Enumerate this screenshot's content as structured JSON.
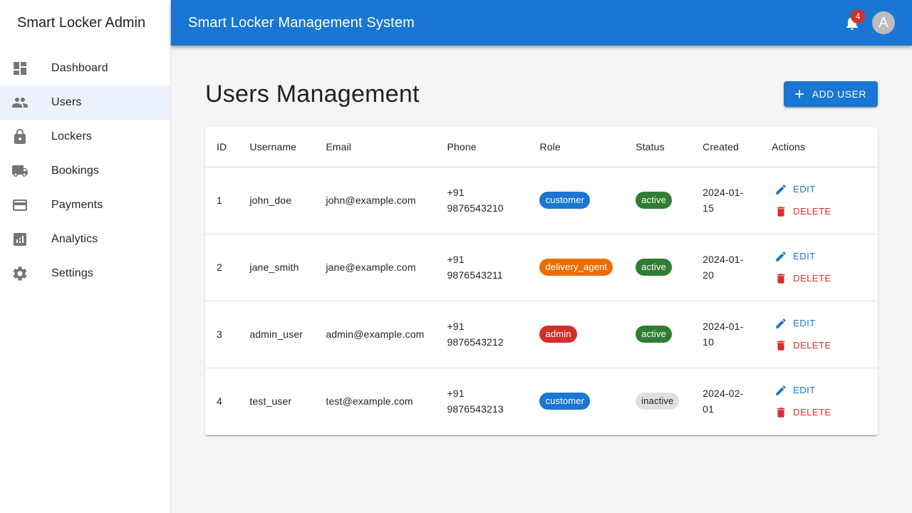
{
  "sidebar": {
    "brand": "Smart Locker Admin",
    "items": [
      {
        "label": "Dashboard",
        "icon": "dashboard-icon"
      },
      {
        "label": "Users",
        "icon": "people-icon",
        "active": true
      },
      {
        "label": "Lockers",
        "icon": "lock-icon"
      },
      {
        "label": "Bookings",
        "icon": "truck-icon"
      },
      {
        "label": "Payments",
        "icon": "credit-card-icon"
      },
      {
        "label": "Analytics",
        "icon": "analytics-icon"
      },
      {
        "label": "Settings",
        "icon": "gear-icon"
      }
    ]
  },
  "appbar": {
    "title": "Smart Locker Management System",
    "notification_count": "4",
    "avatar_initial": "A"
  },
  "page": {
    "title": "Users Management",
    "add_button_label": "ADD USER"
  },
  "table": {
    "headers": [
      "ID",
      "Username",
      "Email",
      "Phone",
      "Role",
      "Status",
      "Created",
      "Actions"
    ],
    "edit_label": "EDIT",
    "delete_label": "DELETE",
    "rows": [
      {
        "id": "1",
        "username": "john_doe",
        "email": "john@example.com",
        "phone_code": "+91",
        "phone_number": "9876543210",
        "role": "customer",
        "status": "active",
        "created_a": "2024-01-",
        "created_b": "15"
      },
      {
        "id": "2",
        "username": "jane_smith",
        "email": "jane@example.com",
        "phone_code": "+91",
        "phone_number": "9876543211",
        "role": "delivery_agent",
        "status": "active",
        "created_a": "2024-01-",
        "created_b": "20"
      },
      {
        "id": "3",
        "username": "admin_user",
        "email": "admin@example.com",
        "phone_code": "+91",
        "phone_number": "9876543212",
        "role": "admin",
        "status": "active",
        "created_a": "2024-01-",
        "created_b": "10"
      },
      {
        "id": "4",
        "username": "test_user",
        "email": "test@example.com",
        "phone_code": "+91",
        "phone_number": "9876543213",
        "role": "customer",
        "status": "inactive",
        "created_a": "2024-02-",
        "created_b": "01"
      }
    ]
  },
  "colors": {
    "primary": "#1976d2",
    "error": "#d32f2f",
    "warning": "#ed6c02",
    "success": "#2e7d32"
  }
}
